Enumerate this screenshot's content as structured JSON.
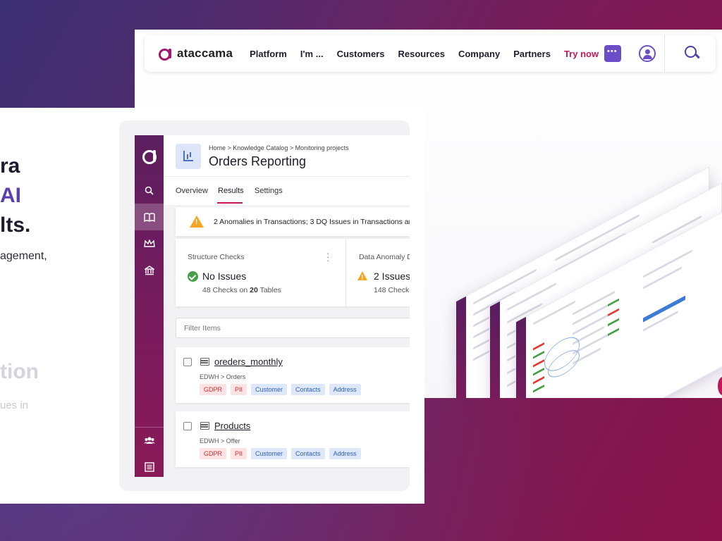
{
  "site": {
    "logo_text": "ataccama",
    "nav": [
      "Platform",
      "I'm ...",
      "Customers",
      "Resources",
      "Company",
      "Partners"
    ],
    "cta": "Try now",
    "icons": [
      "chat-icon",
      "user-icon",
      "search-icon"
    ]
  },
  "hero": {
    "line1": "ra",
    "line2": "AI",
    "line3": "lts.",
    "sub": "agement,",
    "faded_title": "tion",
    "faded_sub": "ues in"
  },
  "app": {
    "breadcrumb": "Home > Knowledge Catalog > Monitoring projects",
    "title": "Orders Reporting",
    "tabs": [
      "Overview",
      "Results",
      "Settings"
    ],
    "active_tab": "Results",
    "alert": "2 Anomalies in Transactions; 3 DQ Issues in Transactions an",
    "structure": {
      "title": "Structure Checks",
      "status": "No Issues",
      "checks": "48",
      "checks_mid": "Checks on",
      "tables": "20",
      "tables_label": "Tables"
    },
    "anomaly": {
      "title": "Data Anomaly D",
      "status": "2 Issues",
      "checks": "148",
      "checks_label": "Checks"
    },
    "filter_placeholder": "Filter Items",
    "items": [
      {
        "name": "oreders_monthly",
        "path": "EDWH > Orders",
        "tags": [
          "GDPR",
          "PII",
          "Customer",
          "Contacts",
          "Address"
        ]
      },
      {
        "name": "Products",
        "path": "EDWH > Offer",
        "tags": [
          "GDPR",
          "PII",
          "Customer",
          "Contacts",
          "Address"
        ]
      }
    ]
  },
  "colors": {
    "brand": "#a3166e",
    "accent": "#c2185b",
    "purple": "#5b3fb0",
    "warning": "#f5a623",
    "success": "#43a047"
  }
}
